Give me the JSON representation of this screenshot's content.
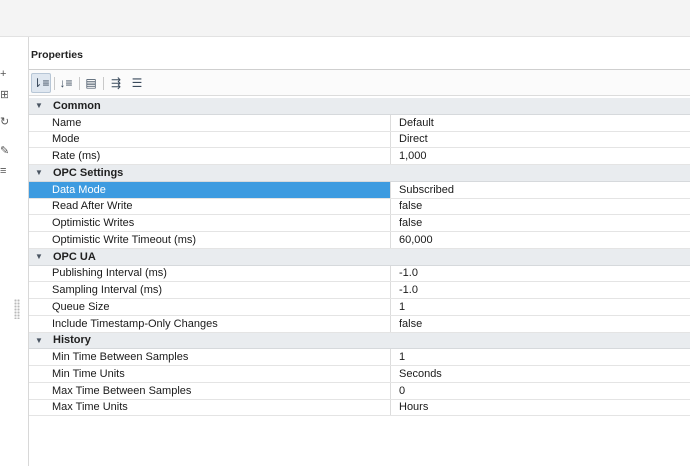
{
  "panel": {
    "title": "Properties"
  },
  "toolbar": {
    "buttons": [
      {
        "icon": "sort-by-category-icon",
        "glyph": "⇂≡",
        "active": true
      },
      {
        "icon": "sort-alphabetical-icon",
        "glyph": "↓≡",
        "active": false
      },
      {
        "icon": "details-panel-icon",
        "glyph": "▤",
        "active": false
      },
      {
        "icon": "expand-all-icon",
        "glyph": "⇶",
        "active": false
      },
      {
        "icon": "collapse-all-icon",
        "glyph": "☰",
        "active": false
      }
    ]
  },
  "categories": [
    {
      "label": "Common",
      "expanded": true,
      "rows": [
        {
          "name": "Name",
          "value": "Default"
        },
        {
          "name": "Mode",
          "value": "Direct"
        },
        {
          "name": "Rate (ms)",
          "value": "1,000"
        }
      ]
    },
    {
      "label": "OPC Settings",
      "expanded": true,
      "rows": [
        {
          "name": "Data Mode",
          "value": "Subscribed",
          "selected": true
        },
        {
          "name": "Read After Write",
          "value": "false"
        },
        {
          "name": "Optimistic Writes",
          "value": "false"
        },
        {
          "name": "Optimistic Write Timeout (ms)",
          "value": "60,000"
        }
      ]
    },
    {
      "label": "OPC UA",
      "expanded": true,
      "rows": [
        {
          "name": "Publishing Interval (ms)",
          "value": "-1.0"
        },
        {
          "name": "Sampling Interval (ms)",
          "value": "-1.0"
        },
        {
          "name": "Queue Size",
          "value": "1"
        },
        {
          "name": "Include Timestamp-Only Changes",
          "value": "false"
        }
      ]
    },
    {
      "label": "History",
      "expanded": true,
      "rows": [
        {
          "name": "Min Time Between Samples",
          "value": "1"
        },
        {
          "name": "Min Time Units",
          "value": "Seconds"
        },
        {
          "name": "Max Time Between Samples",
          "value": "0"
        },
        {
          "name": "Max Time Units",
          "value": "Hours"
        }
      ]
    }
  ],
  "colors": {
    "selection": "#3d9be0",
    "category_bg": "#e9ecef"
  }
}
